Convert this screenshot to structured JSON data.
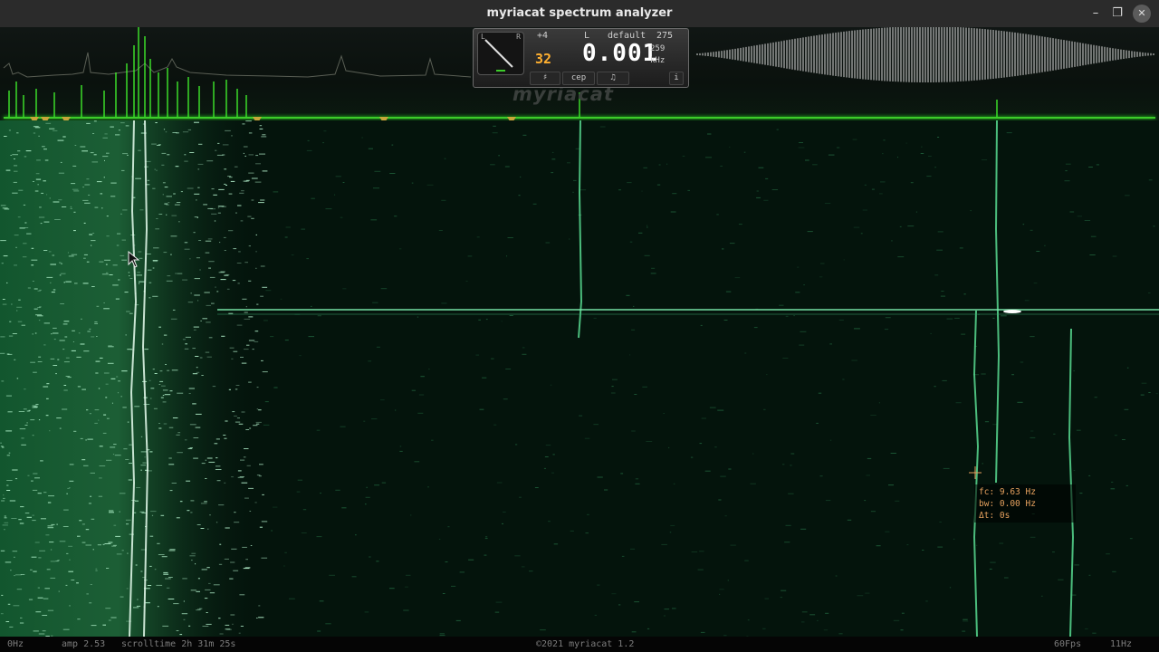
{
  "window": {
    "title": "myriacat spectrum analyzer",
    "minimize_glyph": "–",
    "maximize_glyph": "❐",
    "close_glyph": "✕"
  },
  "panel": {
    "gauge_left": "L",
    "gauge_right": "R",
    "scale": "+4",
    "channel": "L",
    "preset": "default",
    "preset_number": "275",
    "fft_size": "32",
    "frequency": "0.001",
    "frequency_sub": "259",
    "frequency_unit": "kHz",
    "btn_sharp": "♯",
    "btn_cep": "cep",
    "btn_note": "♫",
    "btn_info": "i"
  },
  "logo_text": "myriacat",
  "measurement": {
    "fc": "fc: 9.63 Hz",
    "bw": "bw: 0.00 Hz",
    "dt": "Δt: 0s"
  },
  "statusbar": {
    "freq_start": "0Hz",
    "amp": "amp 2.53",
    "scrolltime": "scrolltime 2h 31m 25s",
    "copyright": "©2021 myriacat 1.2",
    "fps": "60Fps",
    "freq_end": "11Hz"
  },
  "colors": {
    "accent_green": "#3dcc2a",
    "waterfall_bg": "#04140c",
    "marker": "#c8a63a",
    "measure_text": "#e6a15e",
    "freq_readout": "#ffffff",
    "fft_readout": "#ffb030"
  },
  "icons": [
    "crosshair-icon",
    "mouse-cursor-icon",
    "sharp-icon",
    "note-icon",
    "info-icon"
  ]
}
